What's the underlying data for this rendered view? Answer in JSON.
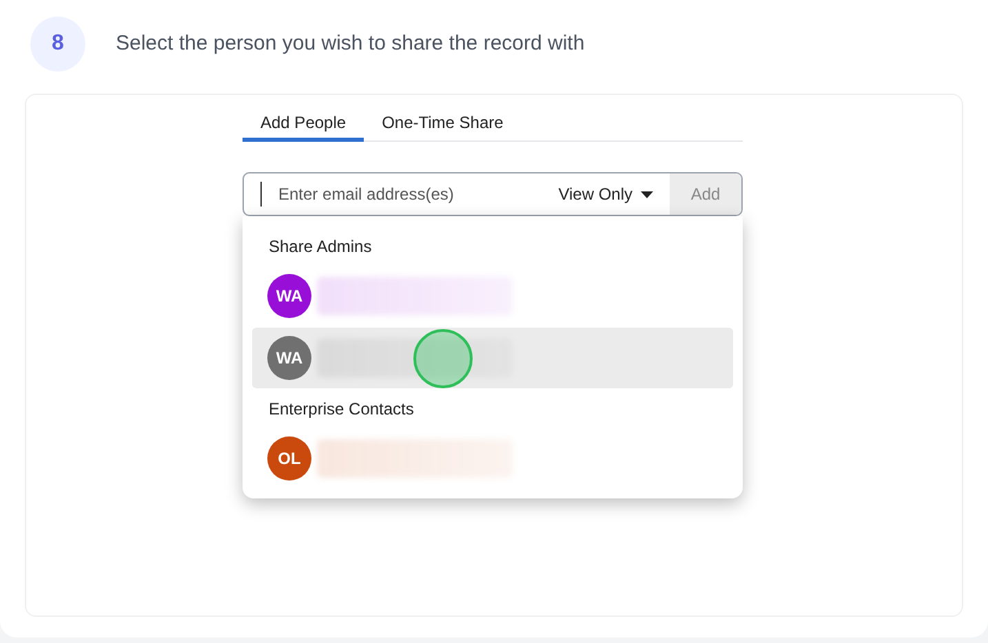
{
  "step": {
    "number": "8",
    "text": "Select the person you wish to share the record with"
  },
  "tabs": [
    {
      "label": "Add People",
      "selected": true
    },
    {
      "label": "One-Time Share",
      "selected": false
    }
  ],
  "email_field": {
    "placeholder": "Enter email address(es)",
    "permission": "View Only",
    "add_button": {
      "label": "Add",
      "disabled": true
    }
  },
  "groups": [
    {
      "title": "Share Admins",
      "contacts": [
        {
          "initials": "WA",
          "color": "#9810d8",
          "selected": false,
          "clicked": false
        },
        {
          "initials": "WA",
          "color": "#707070",
          "selected": true,
          "clicked": true
        }
      ]
    },
    {
      "title": "Enterprise Contacts",
      "contacts": [
        {
          "initials": "OL",
          "color": "#c94a0c",
          "selected": false,
          "clicked": false
        }
      ]
    }
  ]
}
